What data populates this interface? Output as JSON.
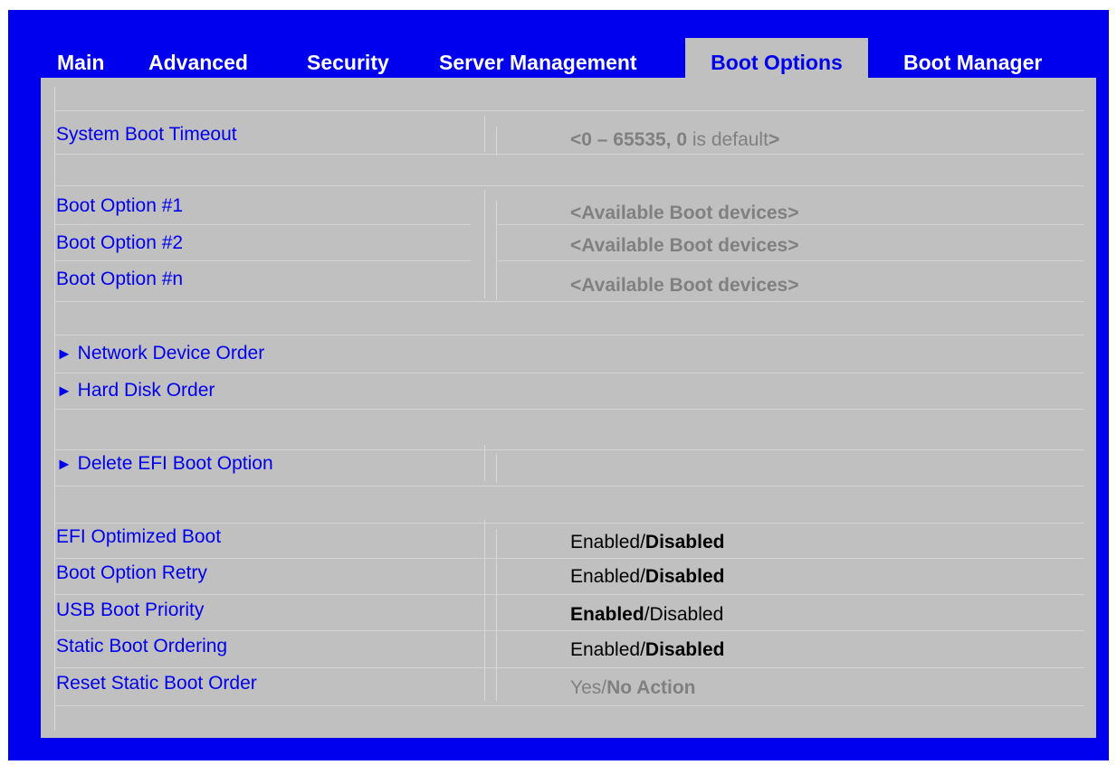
{
  "tabs": [
    {
      "label": "Main"
    },
    {
      "label": "Advanced"
    },
    {
      "label": "Security"
    },
    {
      "label": "Server Management"
    },
    {
      "label": "Boot Options"
    },
    {
      "label": "Boot Manager"
    }
  ],
  "active_tab": "Boot Options",
  "settings": {
    "system_boot_timeout": {
      "label": "System Boot Timeout",
      "value_bold": "<0 – 65535, 0",
      "value_rest": " is default",
      "value_close": ">"
    },
    "boot_option_1": {
      "label": "Boot Option #1",
      "value": "<Available Boot devices>"
    },
    "boot_option_2": {
      "label": "Boot Option #2",
      "value": "<Available Boot devices>"
    },
    "boot_option_n": {
      "label": "Boot Option #n",
      "value": "<Available Boot devices>"
    },
    "network_device_order": {
      "arrow": "►",
      "label": "Network Device Order"
    },
    "hard_disk_order": {
      "arrow": "►",
      "label": "Hard Disk Order"
    },
    "delete_efi_boot_option": {
      "arrow": "►",
      "label": "Delete EFI Boot Option"
    },
    "efi_optimized_boot": {
      "label": "EFI Optimized Boot",
      "opt1": "Enabled",
      "slash": "/",
      "opt2": "Disabled"
    },
    "boot_option_retry": {
      "label": "Boot Option Retry",
      "opt1": "Enabled",
      "slash": "/",
      "opt2": "Disabled"
    },
    "usb_boot_priority": {
      "label": "USB Boot Priority",
      "opt1": "Enabled",
      "slash": "/",
      "opt2": "Disabled"
    },
    "static_boot_ordering": {
      "label": "Static Boot Ordering",
      "opt1": "Enabled",
      "slash": "/",
      "opt2": "Disabled"
    },
    "reset_static_boot_order": {
      "label": "Reset Static Boot Order",
      "opt1": "Yes",
      "slash": "/",
      "opt2": "No Action"
    }
  },
  "colors": {
    "frame": "#0000ee",
    "panel": "#c0c0c0",
    "label": "#0000ee",
    "tab_text": "#ffffff",
    "grey_value": "#808080"
  }
}
